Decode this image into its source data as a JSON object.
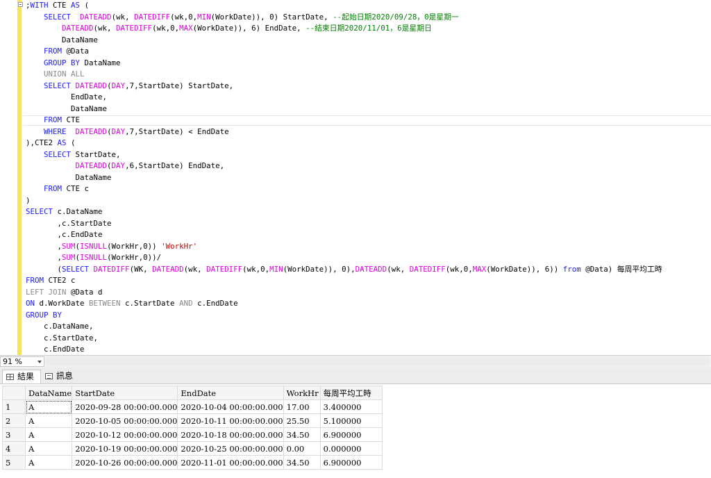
{
  "editor": {
    "lines": [
      [
        {
          "t": ";"
        },
        {
          "t": "WITH",
          "c": "kw"
        },
        {
          "t": " CTE "
        },
        {
          "t": "AS",
          "c": "kw"
        },
        {
          "t": " ("
        }
      ],
      [
        {
          "t": "    "
        },
        {
          "t": "SELECT",
          "c": "kw"
        },
        {
          "t": "  "
        },
        {
          "t": "DATEADD",
          "c": "fn"
        },
        {
          "t": "(wk, "
        },
        {
          "t": "DATEDIFF",
          "c": "fn"
        },
        {
          "t": "(wk,0,"
        },
        {
          "t": "MIN",
          "c": "fn"
        },
        {
          "t": "(WorkDate)), 0) StartDate, "
        },
        {
          "t": "--起始日期2020/09/28，0是星期一",
          "c": "cm"
        }
      ],
      [
        {
          "t": "        "
        },
        {
          "t": "DATEADD",
          "c": "fn"
        },
        {
          "t": "(wk, "
        },
        {
          "t": "DATEDIFF",
          "c": "fn"
        },
        {
          "t": "(wk,0,"
        },
        {
          "t": "MAX",
          "c": "fn"
        },
        {
          "t": "(WorkDate)), 6) EndDate, "
        },
        {
          "t": "--結束日期2020/11/01，6是星期日",
          "c": "cm"
        }
      ],
      [
        {
          "t": "        DataName"
        }
      ],
      [
        {
          "t": "    "
        },
        {
          "t": "FROM",
          "c": "kw"
        },
        {
          "t": " @Data"
        }
      ],
      [
        {
          "t": "    "
        },
        {
          "t": "GROUP BY",
          "c": "kw"
        },
        {
          "t": " DataName"
        }
      ],
      [
        {
          "t": "    "
        },
        {
          "t": "UNION ALL",
          "c": "gy"
        }
      ],
      [
        {
          "t": "    "
        },
        {
          "t": "SELECT",
          "c": "kw"
        },
        {
          "t": " "
        },
        {
          "t": "DATEADD",
          "c": "fn"
        },
        {
          "t": "("
        },
        {
          "t": "DAY",
          "c": "fn"
        },
        {
          "t": ",7,StartDate) StartDate,"
        }
      ],
      [
        {
          "t": "          EndDate,"
        }
      ],
      [
        {
          "t": "          DataName"
        }
      ],
      [
        {
          "t": "    "
        },
        {
          "t": "FROM",
          "c": "kw"
        },
        {
          "t": " CTE"
        }
      ],
      [
        {
          "t": "    "
        },
        {
          "t": "WHERE",
          "c": "kw"
        },
        {
          "t": "  "
        },
        {
          "t": "DATEADD",
          "c": "fn"
        },
        {
          "t": "("
        },
        {
          "t": "DAY",
          "c": "fn"
        },
        {
          "t": ",7,StartDate) < EndDate"
        }
      ],
      [
        {
          "t": "),CTE2 "
        },
        {
          "t": "AS",
          "c": "kw"
        },
        {
          "t": " ("
        }
      ],
      [
        {
          "t": "    "
        },
        {
          "t": "SELECT",
          "c": "kw"
        },
        {
          "t": " StartDate,"
        }
      ],
      [
        {
          "t": "           "
        },
        {
          "t": "DATEADD",
          "c": "fn"
        },
        {
          "t": "("
        },
        {
          "t": "DAY",
          "c": "fn"
        },
        {
          "t": ",6,StartDate) EndDate,"
        }
      ],
      [
        {
          "t": "           DataName"
        }
      ],
      [
        {
          "t": "    "
        },
        {
          "t": "FROM",
          "c": "kw"
        },
        {
          "t": " CTE c"
        }
      ],
      [
        {
          "t": ")"
        }
      ],
      [
        {
          "t": "SELECT",
          "c": "kw"
        },
        {
          "t": " c.DataName"
        }
      ],
      [
        {
          "t": "       ,c.StartDate"
        }
      ],
      [
        {
          "t": "       ,c.EndDate"
        }
      ],
      [
        {
          "t": "       ,"
        },
        {
          "t": "SUM",
          "c": "fn"
        },
        {
          "t": "("
        },
        {
          "t": "ISNULL",
          "c": "fn"
        },
        {
          "t": "(WorkHr,0)) "
        },
        {
          "t": "'WorkHr'",
          "c": "st"
        }
      ],
      [
        {
          "t": "       ,"
        },
        {
          "t": "SUM",
          "c": "fn"
        },
        {
          "t": "("
        },
        {
          "t": "ISNULL",
          "c": "fn"
        },
        {
          "t": "(WorkHr,0))/"
        }
      ],
      [
        {
          "t": "       ("
        },
        {
          "t": "SELECT",
          "c": "kw"
        },
        {
          "t": " "
        },
        {
          "t": "DATEDIFF",
          "c": "fn"
        },
        {
          "t": "(WK, "
        },
        {
          "t": "DATEADD",
          "c": "fn"
        },
        {
          "t": "(wk, "
        },
        {
          "t": "DATEDIFF",
          "c": "fn"
        },
        {
          "t": "(wk,0,"
        },
        {
          "t": "MIN",
          "c": "fn"
        },
        {
          "t": "(WorkDate)), 0),"
        },
        {
          "t": "DATEADD",
          "c": "fn"
        },
        {
          "t": "(wk, "
        },
        {
          "t": "DATEDIFF",
          "c": "fn"
        },
        {
          "t": "(wk,0,"
        },
        {
          "t": "MAX",
          "c": "fn"
        },
        {
          "t": "(WorkDate)), 6)) "
        },
        {
          "t": "from",
          "c": "kw"
        },
        {
          "t": " @Data) 每周平均工時"
        }
      ],
      [
        {
          "t": "FROM",
          "c": "kw"
        },
        {
          "t": " CTE2 c"
        }
      ],
      [
        {
          "t": "LEFT JOIN",
          "c": "gy"
        },
        {
          "t": " @Data d"
        }
      ],
      [
        {
          "t": "ON",
          "c": "kw"
        },
        {
          "t": " d.WorkDate "
        },
        {
          "t": "BETWEEN",
          "c": "gy"
        },
        {
          "t": " c.StartDate "
        },
        {
          "t": "AND",
          "c": "gy"
        },
        {
          "t": " c.EndDate"
        }
      ],
      [
        {
          "t": "GROUP BY",
          "c": "kw"
        }
      ],
      [
        {
          "t": "    c.DataName,"
        }
      ],
      [
        {
          "t": "    c.StartDate,"
        }
      ],
      [
        {
          "t": "    c.EndDate"
        }
      ]
    ]
  },
  "zoom": {
    "value": "91 %"
  },
  "tabs": {
    "results": "結果",
    "messages": "訊息"
  },
  "results": {
    "columns": [
      "DataName",
      "StartDate",
      "EndDate",
      "WorkHr",
      "每周平均工時"
    ],
    "rows": [
      {
        "num": "1",
        "cells": [
          "A",
          "2020-09-28 00:00:00.000",
          "2020-10-04 00:00:00.000",
          "17.00",
          "3.400000"
        ]
      },
      {
        "num": "2",
        "cells": [
          "A",
          "2020-10-05 00:00:00.000",
          "2020-10-11 00:00:00.000",
          "25.50",
          "5.100000"
        ]
      },
      {
        "num": "3",
        "cells": [
          "A",
          "2020-10-12 00:00:00.000",
          "2020-10-18 00:00:00.000",
          "34.50",
          "6.900000"
        ]
      },
      {
        "num": "4",
        "cells": [
          "A",
          "2020-10-19 00:00:00.000",
          "2020-10-25 00:00:00.000",
          "0.00",
          "0.000000"
        ]
      },
      {
        "num": "5",
        "cells": [
          "A",
          "2020-10-26 00:00:00.000",
          "2020-11-01 00:00:00.000",
          "34.50",
          "6.900000"
        ]
      }
    ]
  }
}
